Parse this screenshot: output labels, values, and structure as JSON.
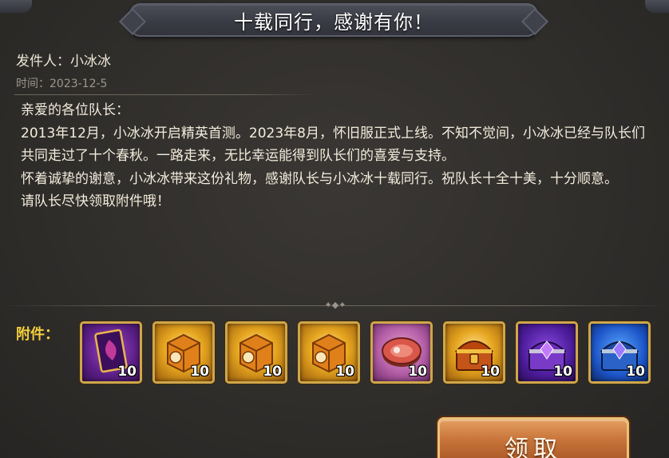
{
  "window": {
    "title": "十载同行，感谢有你！"
  },
  "mail": {
    "sender": "发件人：小冰冰",
    "time": "时间：2023-12-5",
    "body": [
      "亲爱的各位队长：",
      "2013年12月，小冰冰开启精英首测。2023年8月，怀旧服正式上线。不知不觉间，小冰冰已经与队长们共同走过了十个春秋。一路走来，无比幸运能得到队长们的喜爱与支持。",
      "怀着诚挚的谢意，小冰冰带来这份礼物，感谢队长与小冰冰十载同行。祝队长十全十美，十分顺意。",
      "请队长尽快领取附件哦！"
    ]
  },
  "attachments": {
    "label": "附件：",
    "items": [
      {
        "icon": "card-icon",
        "qty": "10"
      },
      {
        "icon": "gold-crate-icon",
        "qty": "10"
      },
      {
        "icon": "gold-crate-icon",
        "qty": "10"
      },
      {
        "icon": "gold-crate-icon",
        "qty": "10"
      },
      {
        "icon": "meat-icon",
        "qty": "10"
      },
      {
        "icon": "gold-chest-icon",
        "qty": "10"
      },
      {
        "icon": "purple-chest-icon",
        "qty": "10"
      },
      {
        "icon": "blue-chest-icon",
        "qty": "10"
      }
    ]
  },
  "actions": {
    "claim_label": "领取"
  },
  "colors": {
    "accent_gold": "#f3cf3c",
    "button_orange": "#c8743a",
    "slot_border": "#cfa64a"
  }
}
